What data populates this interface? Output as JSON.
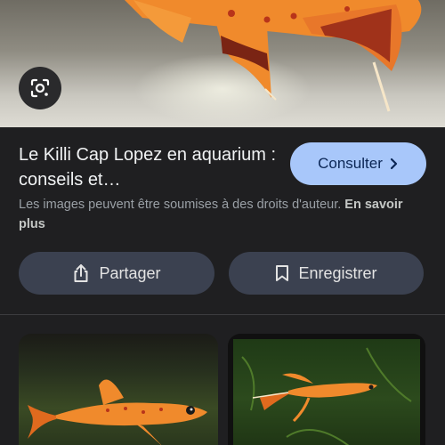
{
  "result": {
    "title": "Le Killi Cap Lopez en aquarium : conseils et…",
    "consult_label": "Consulter",
    "notice_text": "Les images peuvent être soumises à des droits d'auteur.",
    "notice_link": "En savoir plus"
  },
  "actions": {
    "share_label": "Partager",
    "save_label": "Enregistrer"
  },
  "icons": {
    "lens": "google-lens-icon",
    "chevron": "chevron-right-icon",
    "share": "share-icon",
    "bookmark": "bookmark-icon"
  },
  "colors": {
    "background": "#1f1f21",
    "consult_button": "#a8c7fa",
    "action_button": "#3b4150",
    "fish_orange": "#f08a2c"
  }
}
